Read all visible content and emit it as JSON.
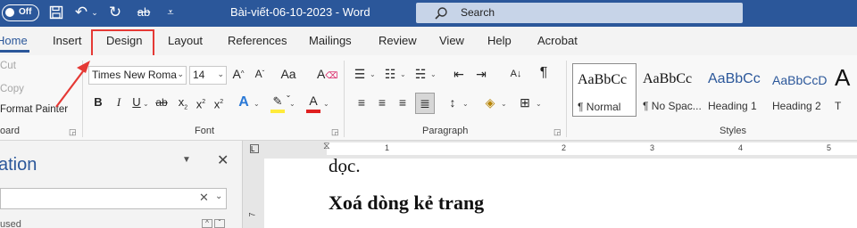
{
  "titlebar": {
    "autosave_label": "Off",
    "doc_title": "Bài-viết-06-10-2023  -  Word",
    "search_placeholder": "Search"
  },
  "tabs": [
    {
      "label": "Home"
    },
    {
      "label": "Insert"
    },
    {
      "label": "Design"
    },
    {
      "label": "Layout"
    },
    {
      "label": "References"
    },
    {
      "label": "Mailings"
    },
    {
      "label": "Review"
    },
    {
      "label": "View"
    },
    {
      "label": "Help"
    },
    {
      "label": "Acrobat"
    }
  ],
  "clipboard": {
    "cut": "Cut",
    "copy": "Copy",
    "format_painter": "Format Painter",
    "group_label": "oard"
  },
  "font": {
    "font_name": "Times New Roma",
    "font_size": "14",
    "change_case": "Aa",
    "bold": "B",
    "italic": "I",
    "underline": "U",
    "strike": "ab",
    "subscript": "x",
    "superscript": "x",
    "clear": "x",
    "effects": "A",
    "font_color": "A",
    "group_label": "Font",
    "highlight_color": "#ffeb3b",
    "font_color_value": "#e02020"
  },
  "paragraph": {
    "show_marks": "¶",
    "group_label": "Paragraph"
  },
  "styles": {
    "items": [
      {
        "preview": "AaBbCc",
        "name": "¶ Normal"
      },
      {
        "preview": "AaBbCc",
        "name": "¶ No Spac..."
      },
      {
        "preview": "AaBbCc",
        "name": "Heading 1"
      },
      {
        "preview": "AaBbCcD",
        "name": "Heading 2"
      },
      {
        "preview": "A",
        "name": "T"
      }
    ],
    "group_label": "Styles"
  },
  "navpane": {
    "title": "ation",
    "used_label": "used"
  },
  "ruler": {
    "numbers": [
      "1",
      "2",
      "3",
      "4",
      "5"
    ],
    "left_marker": "7"
  },
  "document": {
    "line1": "dọc.",
    "line2": "Xoá dòng kẻ trang"
  },
  "colors": {
    "accent": "#2b579a",
    "highlight_box": "#e53935"
  }
}
